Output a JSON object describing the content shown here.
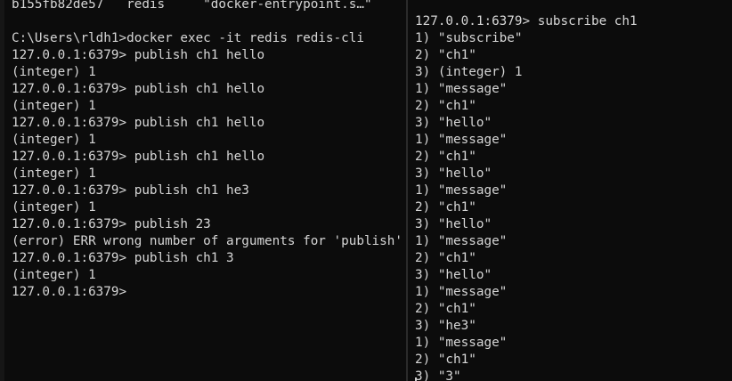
{
  "left_terminal": {
    "top_partial_line": "b155fb82de57   redis     \"docker-entrypoint.s…\"",
    "lines": [
      "",
      "C:\\Users\\rldh1>docker exec -it redis redis-cli",
      "127.0.0.1:6379> publish ch1 hello",
      "(integer) 1",
      "127.0.0.1:6379> publish ch1 hello",
      "(integer) 1",
      "127.0.0.1:6379> publish ch1 hello",
      "(integer) 1",
      "127.0.0.1:6379> publish ch1 hello",
      "(integer) 1",
      "127.0.0.1:6379> publish ch1 he3",
      "(integer) 1",
      "127.0.0.1:6379> publish 23",
      "(error) ERR wrong number of arguments for 'publish'",
      "127.0.0.1:6379> publish ch1 3",
      "(integer) 1",
      "127.0.0.1:6379> "
    ]
  },
  "right_terminal": {
    "lines": [
      "127.0.0.1:6379> subscribe ch1",
      "1) \"subscribe\"",
      "2) \"ch1\"",
      "3) (integer) 1",
      "1) \"message\"",
      "2) \"ch1\"",
      "3) \"hello\"",
      "1) \"message\"",
      "2) \"ch1\"",
      "3) \"hello\"",
      "1) \"message\"",
      "2) \"ch1\"",
      "3) \"hello\"",
      "1) \"message\"",
      "2) \"ch1\"",
      "3) \"hello\"",
      "1) \"message\"",
      "2) \"ch1\"",
      "3) \"he3\"",
      "1) \"message\"",
      "2) \"ch1\"",
      "3) \"3\""
    ]
  },
  "colors": {
    "background": "#0c0c0c",
    "text": "#d6d6d6",
    "divider": "#2b2b2b"
  }
}
